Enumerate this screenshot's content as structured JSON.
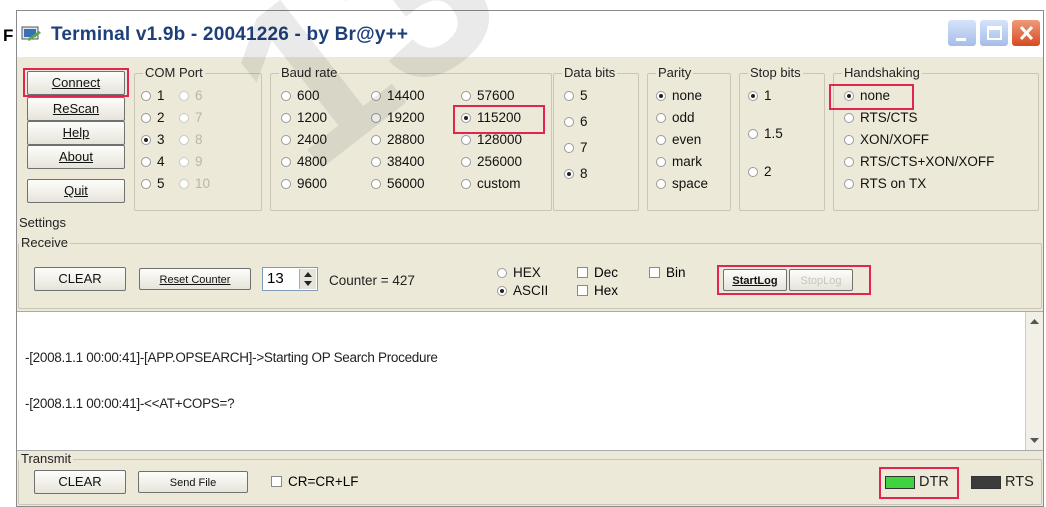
{
  "prefix_letter": "F",
  "window": {
    "title": "Terminal v1.9b - 20041226 - by Br@y++"
  },
  "buttons": {
    "connect": "Connect",
    "rescan": "ReScan",
    "help": "Help",
    "about": "About",
    "quit": "Quit"
  },
  "com_port": {
    "title": "COM Port",
    "col1": [
      {
        "label": "1",
        "selected": false
      },
      {
        "label": "2",
        "selected": false
      },
      {
        "label": "3",
        "selected": true
      },
      {
        "label": "4",
        "selected": false
      },
      {
        "label": "5",
        "selected": false
      }
    ],
    "col2": [
      {
        "label": "6",
        "selected": false
      },
      {
        "label": "7",
        "selected": false
      },
      {
        "label": "8",
        "selected": false
      },
      {
        "label": "9",
        "selected": false
      },
      {
        "label": "10",
        "selected": false
      }
    ]
  },
  "baud_rate": {
    "title": "Baud rate",
    "col1": [
      {
        "label": "600",
        "selected": false
      },
      {
        "label": "1200",
        "selected": false
      },
      {
        "label": "2400",
        "selected": false
      },
      {
        "label": "4800",
        "selected": false
      },
      {
        "label": "9600",
        "selected": false
      }
    ],
    "col2": [
      {
        "label": "14400",
        "selected": false
      },
      {
        "label": "19200",
        "selected": false
      },
      {
        "label": "28800",
        "selected": false
      },
      {
        "label": "38400",
        "selected": false
      },
      {
        "label": "56000",
        "selected": false
      }
    ],
    "col3": [
      {
        "label": "57600",
        "selected": false
      },
      {
        "label": "115200",
        "selected": true
      },
      {
        "label": "128000",
        "selected": false
      },
      {
        "label": "256000",
        "selected": false
      },
      {
        "label": "custom",
        "selected": false
      }
    ]
  },
  "data_bits": {
    "title": "Data bits",
    "options": [
      {
        "label": "5",
        "selected": false
      },
      {
        "label": "6",
        "selected": false
      },
      {
        "label": "7",
        "selected": false
      },
      {
        "label": "8",
        "selected": true
      }
    ]
  },
  "parity": {
    "title": "Parity",
    "options": [
      {
        "label": "none",
        "selected": true
      },
      {
        "label": "odd",
        "selected": false
      },
      {
        "label": "even",
        "selected": false
      },
      {
        "label": "mark",
        "selected": false
      },
      {
        "label": "space",
        "selected": false
      }
    ]
  },
  "stop_bits": {
    "title": "Stop bits",
    "options": [
      {
        "label": "1",
        "selected": true
      },
      {
        "label": "1.5",
        "selected": false
      },
      {
        "label": "2",
        "selected": false
      }
    ]
  },
  "handshaking": {
    "title": "Handshaking",
    "options": [
      {
        "label": "none",
        "selected": true
      },
      {
        "label": "RTS/CTS",
        "selected": false
      },
      {
        "label": "XON/XOFF",
        "selected": false
      },
      {
        "label": "RTS/CTS+XON/XOFF",
        "selected": false
      },
      {
        "label": "RTS on TX",
        "selected": false
      }
    ]
  },
  "settings_label": "Settings",
  "receive": {
    "title": "Receive",
    "clear": "CLEAR",
    "reset_counter": "Reset Counter",
    "spin_value": "13",
    "counter_text": "Counter = 427",
    "hex": "HEX",
    "ascii": "ASCII",
    "dec": "Dec",
    "hex_chk": "Hex",
    "bin": "Bin",
    "start_log": "StartLog",
    "stop_log": "StopLog"
  },
  "log": {
    "lines": [
      "-[2008.1.1 00:00:41]-[APP.OPSEARCH]->Starting OP Search Procedure",
      "-[2008.1.1 00:00:41]-<<AT+COPS=?"
    ]
  },
  "transmit": {
    "title": "Transmit",
    "clear": "CLEAR",
    "send_file": "Send File",
    "cr_label": "CR=CR+LF",
    "dtr": "DTR",
    "rts": "RTS"
  },
  "watermark": "130.co",
  "colors": {
    "highlight": "#e2244f",
    "dtr_led": "#3fd43f",
    "rts_led": "#3c3c3c"
  }
}
